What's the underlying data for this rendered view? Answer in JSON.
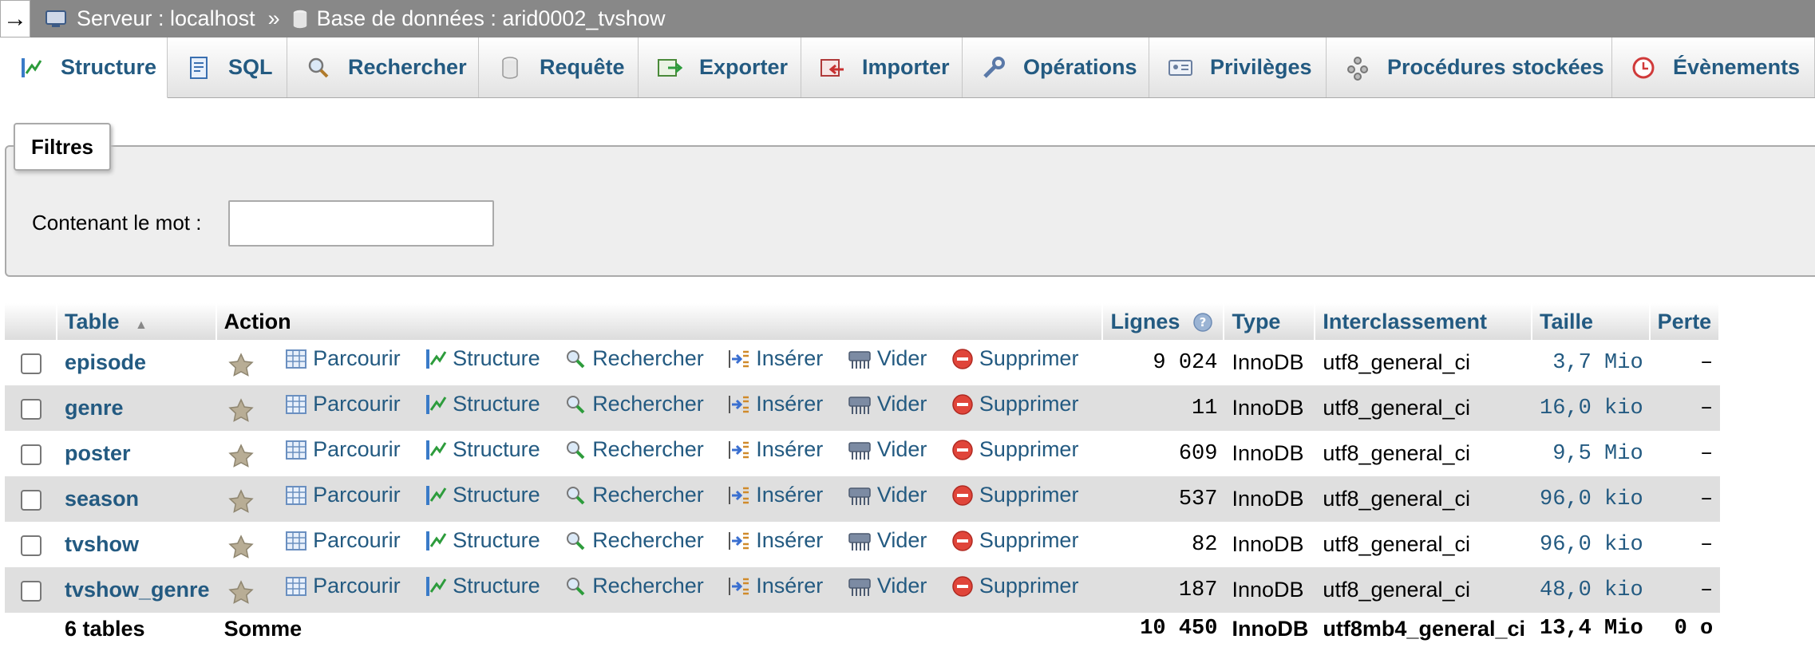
{
  "breadcrumb": {
    "arrow": "→",
    "server": "Serveur : localhost",
    "separator": "»",
    "database": "Base de données : arid0002_tvshow"
  },
  "tabs": [
    {
      "label": "Structure",
      "icon": "structure-icon"
    },
    {
      "label": "SQL",
      "icon": "sql-icon"
    },
    {
      "label": "Rechercher",
      "icon": "search-icon"
    },
    {
      "label": "Requête",
      "icon": "query-icon"
    },
    {
      "label": "Exporter",
      "icon": "export-icon"
    },
    {
      "label": "Importer",
      "icon": "import-icon"
    },
    {
      "label": "Opérations",
      "icon": "wrench-icon"
    },
    {
      "label": "Privilèges",
      "icon": "privileges-icon"
    },
    {
      "label": "Procédures stockées",
      "icon": "routines-icon"
    },
    {
      "label": "Évènements",
      "icon": "clock-icon"
    }
  ],
  "filters": {
    "legend": "Filtres",
    "label": "Contenant le mot :",
    "value": ""
  },
  "table": {
    "headers": {
      "table": "Table",
      "sort_indicator": "▲",
      "action": "Action",
      "rows": "Lignes",
      "type": "Type",
      "collation": "Interclassement",
      "size": "Taille",
      "overhead": "Perte"
    },
    "actions": {
      "browse": "Parcourir",
      "structure": "Structure",
      "search": "Rechercher",
      "insert": "Insérer",
      "empty": "Vider",
      "drop": "Supprimer"
    },
    "rows": [
      {
        "name": "episode",
        "rows": "9 024",
        "type": "InnoDB",
        "collation": "utf8_general_ci",
        "size": "3,7 Mio",
        "overhead": "–"
      },
      {
        "name": "genre",
        "rows": "11",
        "type": "InnoDB",
        "collation": "utf8_general_ci",
        "size": "16,0 kio",
        "overhead": "–"
      },
      {
        "name": "poster",
        "rows": "609",
        "type": "InnoDB",
        "collation": "utf8_general_ci",
        "size": "9,5 Mio",
        "overhead": "–"
      },
      {
        "name": "season",
        "rows": "537",
        "type": "InnoDB",
        "collation": "utf8_general_ci",
        "size": "96,0 kio",
        "overhead": "–"
      },
      {
        "name": "tvshow",
        "rows": "82",
        "type": "InnoDB",
        "collation": "utf8_general_ci",
        "size": "96,0 kio",
        "overhead": "–"
      },
      {
        "name": "tvshow_genre",
        "rows": "187",
        "type": "InnoDB",
        "collation": "utf8_general_ci",
        "size": "48,0 kio",
        "overhead": "–"
      }
    ],
    "footer": {
      "count": "6 tables",
      "label": "Somme",
      "rows": "10 450",
      "type": "InnoDB",
      "collation": "utf8mb4_general_ci",
      "size": "13,4 Mio",
      "overhead": "0 o"
    }
  },
  "colors": {
    "link": "#235a81",
    "breadcrumb_bg": "#888888",
    "row_alt": "#dfdfdf"
  }
}
